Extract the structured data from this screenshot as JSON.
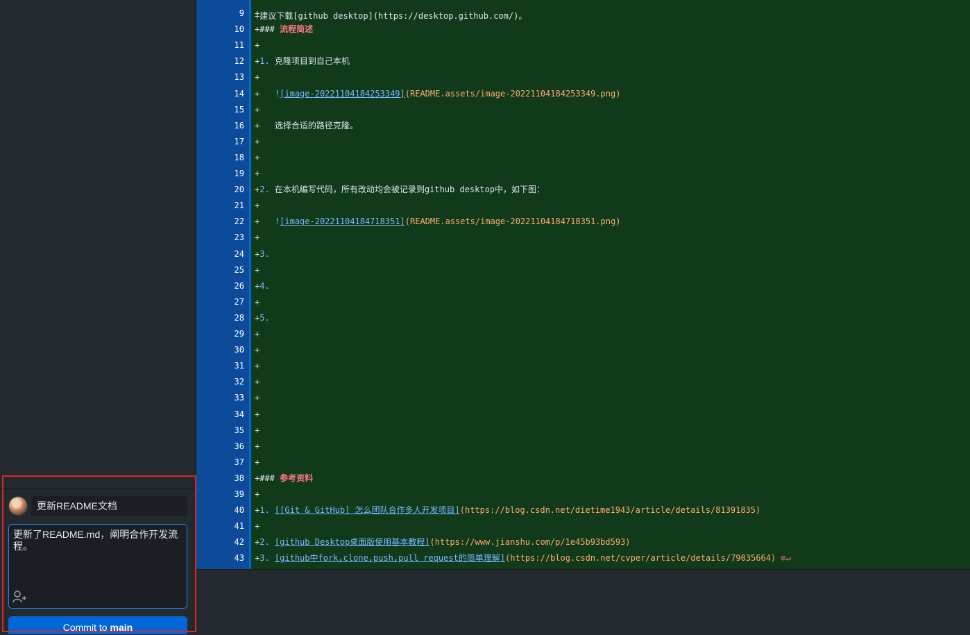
{
  "commit": {
    "summary": "更新README文档",
    "description": "更新了README.md，阐明合作开发流程。",
    "button_prefix": "Commit to",
    "branch": "main"
  },
  "diff": {
    "top_partial": "+建议下载[github desktop](https://desktop.github.com/)。",
    "lines": [
      {
        "n": "9",
        "parts": [
          {
            "t": "+",
            "c": "plus"
          }
        ]
      },
      {
        "n": "10",
        "parts": [
          {
            "t": "+### ",
            "c": "plus"
          },
          {
            "t": "流程简述",
            "c": "heading"
          }
        ]
      },
      {
        "n": "11",
        "parts": [
          {
            "t": "+",
            "c": "plus"
          }
        ]
      },
      {
        "n": "12",
        "parts": [
          {
            "t": "+",
            "c": "plus"
          },
          {
            "t": "1.",
            "c": "listnum"
          },
          {
            "t": " 克隆项目到自己本机",
            "c": "cn"
          }
        ]
      },
      {
        "n": "13",
        "parts": [
          {
            "t": "+",
            "c": "plus"
          }
        ]
      },
      {
        "n": "14",
        "parts": [
          {
            "t": "+   ",
            "c": "plus"
          },
          {
            "t": "!",
            "c": "listnum"
          },
          {
            "t": "[image-20221104184253349]",
            "c": "link"
          },
          {
            "t": "(README.assets/image-20221104184253349.png)",
            "c": "url"
          }
        ]
      },
      {
        "n": "15",
        "parts": [
          {
            "t": "+",
            "c": "plus"
          }
        ]
      },
      {
        "n": "16",
        "parts": [
          {
            "t": "+   选择合适的路径克隆。",
            "c": "cn"
          }
        ]
      },
      {
        "n": "17",
        "parts": [
          {
            "t": "+",
            "c": "plus"
          }
        ]
      },
      {
        "n": "18",
        "parts": [
          {
            "t": "+",
            "c": "plus"
          }
        ]
      },
      {
        "n": "19",
        "parts": [
          {
            "t": "+",
            "c": "plus"
          }
        ]
      },
      {
        "n": "20",
        "parts": [
          {
            "t": "+",
            "c": "plus"
          },
          {
            "t": "2.",
            "c": "listnum"
          },
          {
            "t": " 在本机编写代码，所有改动均会被记录到github desktop中，如下图：",
            "c": "cn"
          }
        ]
      },
      {
        "n": "21",
        "parts": [
          {
            "t": "+",
            "c": "plus"
          }
        ]
      },
      {
        "n": "22",
        "parts": [
          {
            "t": "+   ",
            "c": "plus"
          },
          {
            "t": "!",
            "c": "listnum"
          },
          {
            "t": "[image-20221104184718351]",
            "c": "link"
          },
          {
            "t": "(README.assets/image-20221104184718351.png)",
            "c": "url"
          }
        ]
      },
      {
        "n": "23",
        "parts": [
          {
            "t": "+",
            "c": "plus"
          }
        ]
      },
      {
        "n": "24",
        "parts": [
          {
            "t": "+",
            "c": "plus"
          },
          {
            "t": "3.",
            "c": "listnum"
          }
        ]
      },
      {
        "n": "25",
        "parts": [
          {
            "t": "+",
            "c": "plus"
          }
        ]
      },
      {
        "n": "26",
        "parts": [
          {
            "t": "+",
            "c": "plus"
          },
          {
            "t": "4.",
            "c": "listnum"
          }
        ]
      },
      {
        "n": "27",
        "parts": [
          {
            "t": "+",
            "c": "plus"
          }
        ]
      },
      {
        "n": "28",
        "parts": [
          {
            "t": "+",
            "c": "plus"
          },
          {
            "t": "5.",
            "c": "listnum"
          }
        ]
      },
      {
        "n": "29",
        "parts": [
          {
            "t": "+",
            "c": "plus"
          }
        ]
      },
      {
        "n": "30",
        "parts": [
          {
            "t": "+",
            "c": "plus"
          }
        ]
      },
      {
        "n": "31",
        "parts": [
          {
            "t": "+",
            "c": "plus"
          }
        ]
      },
      {
        "n": "32",
        "parts": [
          {
            "t": "+",
            "c": "plus"
          }
        ]
      },
      {
        "n": "33",
        "parts": [
          {
            "t": "+",
            "c": "plus"
          }
        ]
      },
      {
        "n": "34",
        "parts": [
          {
            "t": "+",
            "c": "plus"
          }
        ]
      },
      {
        "n": "35",
        "parts": [
          {
            "t": "+",
            "c": "plus"
          }
        ]
      },
      {
        "n": "36",
        "parts": [
          {
            "t": "+",
            "c": "plus"
          }
        ]
      },
      {
        "n": "37",
        "parts": [
          {
            "t": "+",
            "c": "plus"
          }
        ]
      },
      {
        "n": "38",
        "parts": [
          {
            "t": "+### ",
            "c": "plus"
          },
          {
            "t": "参考资料",
            "c": "heading"
          }
        ]
      },
      {
        "n": "39",
        "parts": [
          {
            "t": "+",
            "c": "plus"
          }
        ]
      },
      {
        "n": "40",
        "parts": [
          {
            "t": "+",
            "c": "plus"
          },
          {
            "t": "1.",
            "c": "listnum"
          },
          {
            "t": " ",
            "c": "plus"
          },
          {
            "t": "[[Git & GitHub] 怎么团队合作多人开发项目]",
            "c": "link"
          },
          {
            "t": "(https://blog.csdn.net/dietime1943/article/details/81391835)",
            "c": "url"
          }
        ]
      },
      {
        "n": "41",
        "parts": [
          {
            "t": "+",
            "c": "plus"
          }
        ]
      },
      {
        "n": "42",
        "parts": [
          {
            "t": "+",
            "c": "plus"
          },
          {
            "t": "2.",
            "c": "listnum"
          },
          {
            "t": " ",
            "c": "plus"
          },
          {
            "t": "[github Desktop桌面版使用基本教程]",
            "c": "link"
          },
          {
            "t": "(https://www.jianshu.com/p/1e45b93bd593)",
            "c": "url"
          }
        ]
      },
      {
        "n": "43",
        "parts": [
          {
            "t": "+",
            "c": "plus"
          },
          {
            "t": "3.",
            "c": "listnum"
          },
          {
            "t": " ",
            "c": "plus"
          },
          {
            "t": "[github中fork,clone,push,pull request的简单理解]",
            "c": "link"
          },
          {
            "t": "(https://blog.csdn.net/cvper/article/details/79035664)",
            "c": "url"
          },
          {
            "t": " ⊘↵",
            "c": "nonl"
          }
        ]
      }
    ]
  },
  "icons": {
    "avatar": "user-avatar",
    "coauthor": "add-coauthor-icon",
    "no_newline": "no-newline-icon"
  },
  "colors": {
    "accent": "#0366d6",
    "diff_added_bg": "#113a1b",
    "highlight": "#e02424"
  }
}
